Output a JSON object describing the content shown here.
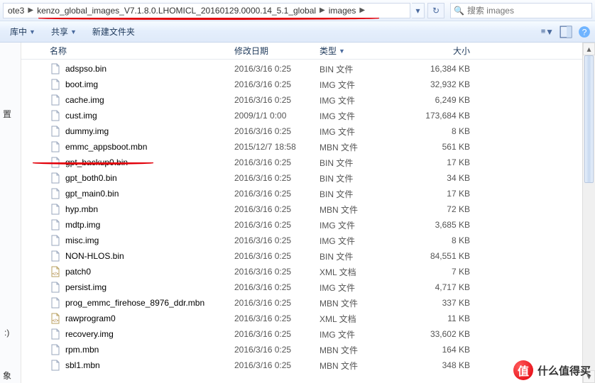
{
  "addressbar": {
    "crumbs": [
      "ote3",
      "kenzo_global_images_V7.1.8.0.LHOMICL_20160129.0000.14_5.1_global",
      "images"
    ],
    "search_placeholder": "搜索 images"
  },
  "toolbar": {
    "library": "库中",
    "share": "共享",
    "newfolder": "新建文件夹"
  },
  "columns": {
    "name": "名称",
    "date": "修改日期",
    "type": "类型",
    "size": "大小"
  },
  "sidebar_fragments": {
    "a": "置",
    "b": ":)"
  },
  "files": [
    {
      "icon": "file",
      "name": "adspso.bin",
      "date": "2016/3/16 0:25",
      "type": "BIN 文件",
      "size": "16,384 KB"
    },
    {
      "icon": "file",
      "name": "boot.img",
      "date": "2016/3/16 0:25",
      "type": "IMG 文件",
      "size": "32,932 KB"
    },
    {
      "icon": "file",
      "name": "cache.img",
      "date": "2016/3/16 0:25",
      "type": "IMG 文件",
      "size": "6,249 KB"
    },
    {
      "icon": "file",
      "name": "cust.img",
      "date": "2009/1/1 0:00",
      "type": "IMG 文件",
      "size": "173,684 KB"
    },
    {
      "icon": "file",
      "name": "dummy.img",
      "date": "2016/3/16 0:25",
      "type": "IMG 文件",
      "size": "8 KB"
    },
    {
      "icon": "file",
      "name": "emmc_appsboot.mbn",
      "date": "2015/12/7 18:58",
      "type": "MBN 文件",
      "size": "561 KB"
    },
    {
      "icon": "file",
      "name": "gpt_backup0.bin",
      "date": "2016/3/16 0:25",
      "type": "BIN 文件",
      "size": "17 KB"
    },
    {
      "icon": "file",
      "name": "gpt_both0.bin",
      "date": "2016/3/16 0:25",
      "type": "BIN 文件",
      "size": "34 KB"
    },
    {
      "icon": "file",
      "name": "gpt_main0.bin",
      "date": "2016/3/16 0:25",
      "type": "BIN 文件",
      "size": "17 KB"
    },
    {
      "icon": "file",
      "name": "hyp.mbn",
      "date": "2016/3/16 0:25",
      "type": "MBN 文件",
      "size": "72 KB"
    },
    {
      "icon": "file",
      "name": "mdtp.img",
      "date": "2016/3/16 0:25",
      "type": "IMG 文件",
      "size": "3,685 KB"
    },
    {
      "icon": "file",
      "name": "misc.img",
      "date": "2016/3/16 0:25",
      "type": "IMG 文件",
      "size": "8 KB"
    },
    {
      "icon": "file",
      "name": "NON-HLOS.bin",
      "date": "2016/3/16 0:25",
      "type": "BIN 文件",
      "size": "84,551 KB"
    },
    {
      "icon": "xml",
      "name": "patch0",
      "date": "2016/3/16 0:25",
      "type": "XML 文档",
      "size": "7 KB"
    },
    {
      "icon": "file",
      "name": "persist.img",
      "date": "2016/3/16 0:25",
      "type": "IMG 文件",
      "size": "4,717 KB"
    },
    {
      "icon": "file",
      "name": "prog_emmc_firehose_8976_ddr.mbn",
      "date": "2016/3/16 0:25",
      "type": "MBN 文件",
      "size": "337 KB"
    },
    {
      "icon": "xml",
      "name": "rawprogram0",
      "date": "2016/3/16 0:25",
      "type": "XML 文档",
      "size": "11 KB"
    },
    {
      "icon": "file",
      "name": "recovery.img",
      "date": "2016/3/16 0:25",
      "type": "IMG 文件",
      "size": "33,602 KB"
    },
    {
      "icon": "file",
      "name": "rpm.mbn",
      "date": "2016/3/16 0:25",
      "type": "MBN 文件",
      "size": "164 KB"
    },
    {
      "icon": "file",
      "name": "sbl1.mbn",
      "date": "2016/3/16 0:25",
      "type": "MBN 文件",
      "size": "348 KB"
    }
  ],
  "watermark": "什么值得买",
  "bottom_label": "象"
}
